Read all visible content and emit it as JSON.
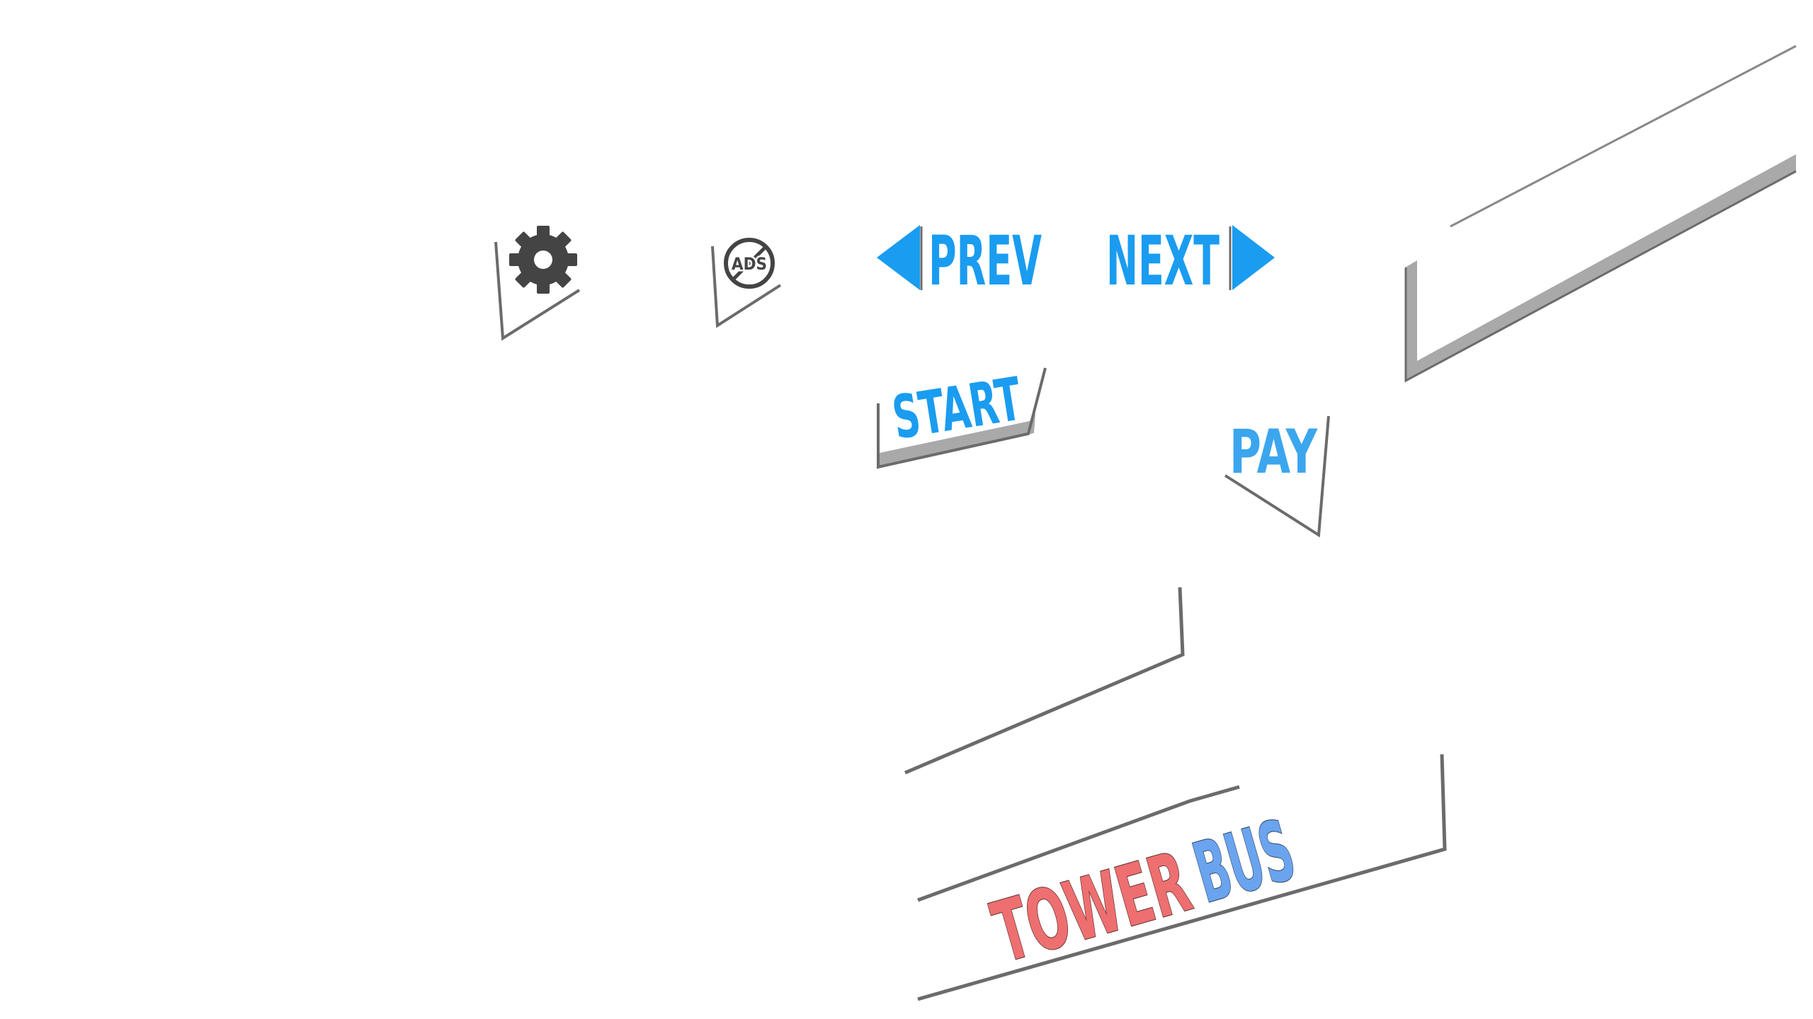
{
  "menu": {
    "prev_label": "PREV",
    "next_label": "NEXT",
    "start_label": "START",
    "pay_label": "PAY",
    "ads_label": "ADS"
  },
  "title": {
    "word1": "TOWER",
    "word2": "BUS"
  },
  "colors": {
    "background": "#ffffff",
    "accent_blue": "#1a9cf0",
    "light_blue": "#3ba6ee",
    "title_red": "#ee6f6f",
    "title_blue": "#6aa4ef",
    "icon_dark": "#444444",
    "line_gray": "#6b6b6b",
    "shadow_gray": "#a9a9a9"
  },
  "icons": {
    "settings": "gear-icon",
    "no_ads": "no-ads-icon",
    "prev": "triangle-left-icon",
    "next": "triangle-right-icon"
  }
}
